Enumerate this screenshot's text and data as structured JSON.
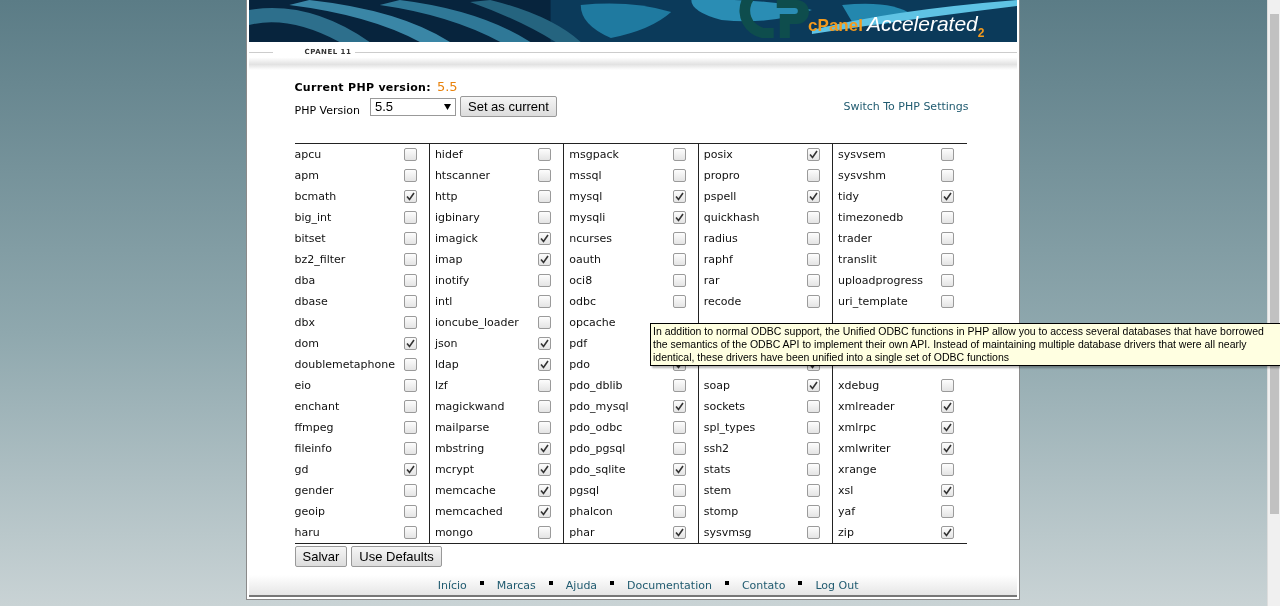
{
  "header": {
    "logo": {
      "brand": "cPanel",
      "product": "Accelerated",
      "edition": "2"
    }
  },
  "section_label": "CPANEL 11",
  "current_version": {
    "label": "Current PHP version:",
    "value": "5.5"
  },
  "version_select": {
    "label": "PHP Version",
    "value": "5.5",
    "button": "Set as current"
  },
  "switch_link": "Switch To PHP Settings",
  "extension_columns": [
    [
      {
        "name": "apcu",
        "checked": false
      },
      {
        "name": "apm",
        "checked": false
      },
      {
        "name": "bcmath",
        "checked": true
      },
      {
        "name": "big_int",
        "checked": false
      },
      {
        "name": "bitset",
        "checked": false
      },
      {
        "name": "bz2_filter",
        "checked": false
      },
      {
        "name": "dba",
        "checked": false
      },
      {
        "name": "dbase",
        "checked": false
      },
      {
        "name": "dbx",
        "checked": false
      },
      {
        "name": "dom",
        "checked": true
      },
      {
        "name": "doublemetaphone",
        "checked": false
      },
      {
        "name": "eio",
        "checked": false
      },
      {
        "name": "enchant",
        "checked": false
      },
      {
        "name": "ffmpeg",
        "checked": false
      },
      {
        "name": "fileinfo",
        "checked": false
      },
      {
        "name": "gd",
        "checked": true
      },
      {
        "name": "gender",
        "checked": false
      },
      {
        "name": "geoip",
        "checked": false
      },
      {
        "name": "haru",
        "checked": false
      }
    ],
    [
      {
        "name": "hidef",
        "checked": false
      },
      {
        "name": "htscanner",
        "checked": false
      },
      {
        "name": "http",
        "checked": false
      },
      {
        "name": "igbinary",
        "checked": false
      },
      {
        "name": "imagick",
        "checked": true
      },
      {
        "name": "imap",
        "checked": true
      },
      {
        "name": "inotify",
        "checked": false
      },
      {
        "name": "intl",
        "checked": false
      },
      {
        "name": "ioncube_loader",
        "checked": false
      },
      {
        "name": "json",
        "checked": true
      },
      {
        "name": "ldap",
        "checked": true
      },
      {
        "name": "lzf",
        "checked": false
      },
      {
        "name": "magickwand",
        "checked": false
      },
      {
        "name": "mailparse",
        "checked": false
      },
      {
        "name": "mbstring",
        "checked": true
      },
      {
        "name": "mcrypt",
        "checked": true
      },
      {
        "name": "memcache",
        "checked": true
      },
      {
        "name": "memcached",
        "checked": true
      },
      {
        "name": "mongo",
        "checked": false
      }
    ],
    [
      {
        "name": "msgpack",
        "checked": false
      },
      {
        "name": "mssql",
        "checked": false
      },
      {
        "name": "mysql",
        "checked": true
      },
      {
        "name": "mysqli",
        "checked": true
      },
      {
        "name": "ncurses",
        "checked": false
      },
      {
        "name": "oauth",
        "checked": false
      },
      {
        "name": "oci8",
        "checked": false
      },
      {
        "name": "odbc",
        "checked": false
      },
      {
        "name": "opcache"
      },
      {
        "name": "pdf"
      },
      {
        "name": "pdo",
        "checked": true
      },
      {
        "name": "pdo_dblib",
        "checked": false
      },
      {
        "name": "pdo_mysql",
        "checked": true
      },
      {
        "name": "pdo_odbc",
        "checked": false
      },
      {
        "name": "pdo_pgsql",
        "checked": false
      },
      {
        "name": "pdo_sqlite",
        "checked": true
      },
      {
        "name": "pgsql",
        "checked": false
      },
      {
        "name": "phalcon",
        "checked": false
      },
      {
        "name": "phar",
        "checked": true
      }
    ],
    [
      {
        "name": "posix",
        "checked": true
      },
      {
        "name": "propro",
        "checked": false
      },
      {
        "name": "pspell",
        "checked": true
      },
      {
        "name": "quickhash",
        "checked": false
      },
      {
        "name": "radius",
        "checked": false
      },
      {
        "name": "raphf",
        "checked": false
      },
      {
        "name": "rar",
        "checked": false
      },
      {
        "name": "recode",
        "checked": false
      },
      null,
      null,
      {
        "checked": true
      },
      {
        "name": "soap",
        "checked": true
      },
      {
        "name": "sockets",
        "checked": false
      },
      {
        "name": "spl_types",
        "checked": false
      },
      {
        "name": "ssh2",
        "checked": false
      },
      {
        "name": "stats",
        "checked": false
      },
      {
        "name": "stem",
        "checked": false
      },
      {
        "name": "stomp",
        "checked": false
      },
      {
        "name": "sysvmsg",
        "checked": false
      }
    ],
    [
      {
        "name": "sysvsem",
        "checked": false
      },
      {
        "name": "sysvshm",
        "checked": false
      },
      {
        "name": "tidy",
        "checked": true
      },
      {
        "name": "timezonedb",
        "checked": false
      },
      {
        "name": "trader",
        "checked": false
      },
      {
        "name": "translit",
        "checked": false
      },
      {
        "name": "uploadprogress",
        "checked": false
      },
      {
        "name": "uri_template",
        "checked": false
      },
      null,
      null,
      null,
      {
        "name": "xdebug",
        "checked": false
      },
      {
        "name": "xmlreader",
        "checked": true
      },
      {
        "name": "xmlrpc",
        "checked": true
      },
      {
        "name": "xmlwriter",
        "checked": true
      },
      {
        "name": "xrange",
        "checked": false
      },
      {
        "name": "xsl",
        "checked": true
      },
      {
        "name": "yaf",
        "checked": false
      },
      {
        "name": "zip",
        "checked": true
      }
    ]
  ],
  "buttons": [
    "Salvar",
    "Use Defaults"
  ],
  "footer_links": [
    "Início",
    "Marcas",
    "Ajuda",
    "Documentation",
    "Contato",
    "Log Out"
  ],
  "tooltip": "In addition to normal ODBC support, the Unified ODBC functions in PHP allow you to access several databases that have borrowed the semantics of the ODBC API to implement their own API. Instead of maintaining multiple database drivers that were all nearly identical, these drivers have been unified into a single set of ODBC functions"
}
